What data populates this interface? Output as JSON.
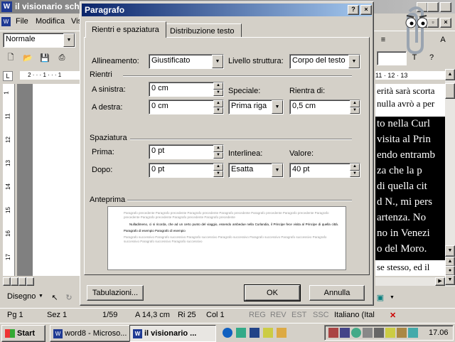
{
  "word": {
    "title": "il visionario schi",
    "menu": [
      "File",
      "Modifica",
      "Visua"
    ],
    "style_combo": "Normale",
    "ruler_right": "11 · 12 · 13",
    "doc_lines_top": [
      "erità sarà scorta",
      "nulla avrò a per"
    ],
    "doc_lines_selected": [
      "to nella Curl",
      "visita al Prin",
      "endo entramb",
      "za che la p",
      "di quella cit",
      "d N., mi pers",
      "artenza. No",
      "no in Venezi",
      "o del Moro. "
    ],
    "doc_line_bottom": "se stesso, ed il",
    "vruler_marks": [
      "1",
      "11",
      "12",
      "13",
      "14",
      "15",
      "16",
      "17"
    ],
    "drawing_label": "Disegno"
  },
  "status": {
    "page": "Pg 1",
    "section": "Sez 1",
    "pages": "1/59",
    "position": "A 14,3 cm",
    "line": "Ri 25",
    "column": "Col 1",
    "rec": "REG",
    "rev": "REV",
    "ext": "EST",
    "ssc": "SSC",
    "language": "Italiano (Ital"
  },
  "taskbar": {
    "start": "Start",
    "tasks": [
      "word8 - Microso...",
      "il visionario ..."
    ],
    "clock": "17.06"
  },
  "dialog": {
    "title": "Paragrafo",
    "tabs": [
      "Rientri e spaziatura",
      "Distribuzione testo"
    ],
    "alignment_label": "Allineamento:",
    "alignment_value": "Giustificato",
    "outline_label": "Livello struttura:",
    "outline_value": "Corpo del testo",
    "indent_group": "Rientri",
    "left_label": "A sinistra:",
    "left_value": "0 cm",
    "right_label": "A destra:",
    "right_value": "0 cm",
    "special_label": "Speciale:",
    "special_value": "Prima riga",
    "by_label": "Rientra di:",
    "by_value": "0,5 cm",
    "spacing_group": "Spaziatura",
    "before_label": "Prima:",
    "before_value": "0 pt",
    "after_label": "Dopo:",
    "after_value": "0 pt",
    "line_spacing_label": "Interlinea:",
    "line_spacing_value": "Esatta",
    "at_label": "Valore:",
    "at_value": "40 pt",
    "preview_group": "Anteprima",
    "preview_prev": "Paragrafo precedente Paragrafo precedente Paragrafo precedente Paragrafo precedente Paragrafo precedente Paragrafo precedente Paragrafo precedente Paragrafo precedente Paragrafo precedente Paragrafo precedente",
    "preview_current": "Nulladimeno, ci si ricorda, che ad un certo punto del viaggio, essendo ambedue nella Curlandia, il Principe fece visita al Principe di quella città. Paragrafo di esempio Paragrafo di esempio",
    "preview_next": "Paragrafo successivo Paragrafo successivo Paragrafo successivo Paragrafo successivo Paragrafo successivo Paragrafo successivo Paragrafo successivo Paragrafo successivo Paragrafo successivo",
    "tabs_button": "Tabulazioni...",
    "ok_button": "OK",
    "cancel_button": "Annulla"
  }
}
